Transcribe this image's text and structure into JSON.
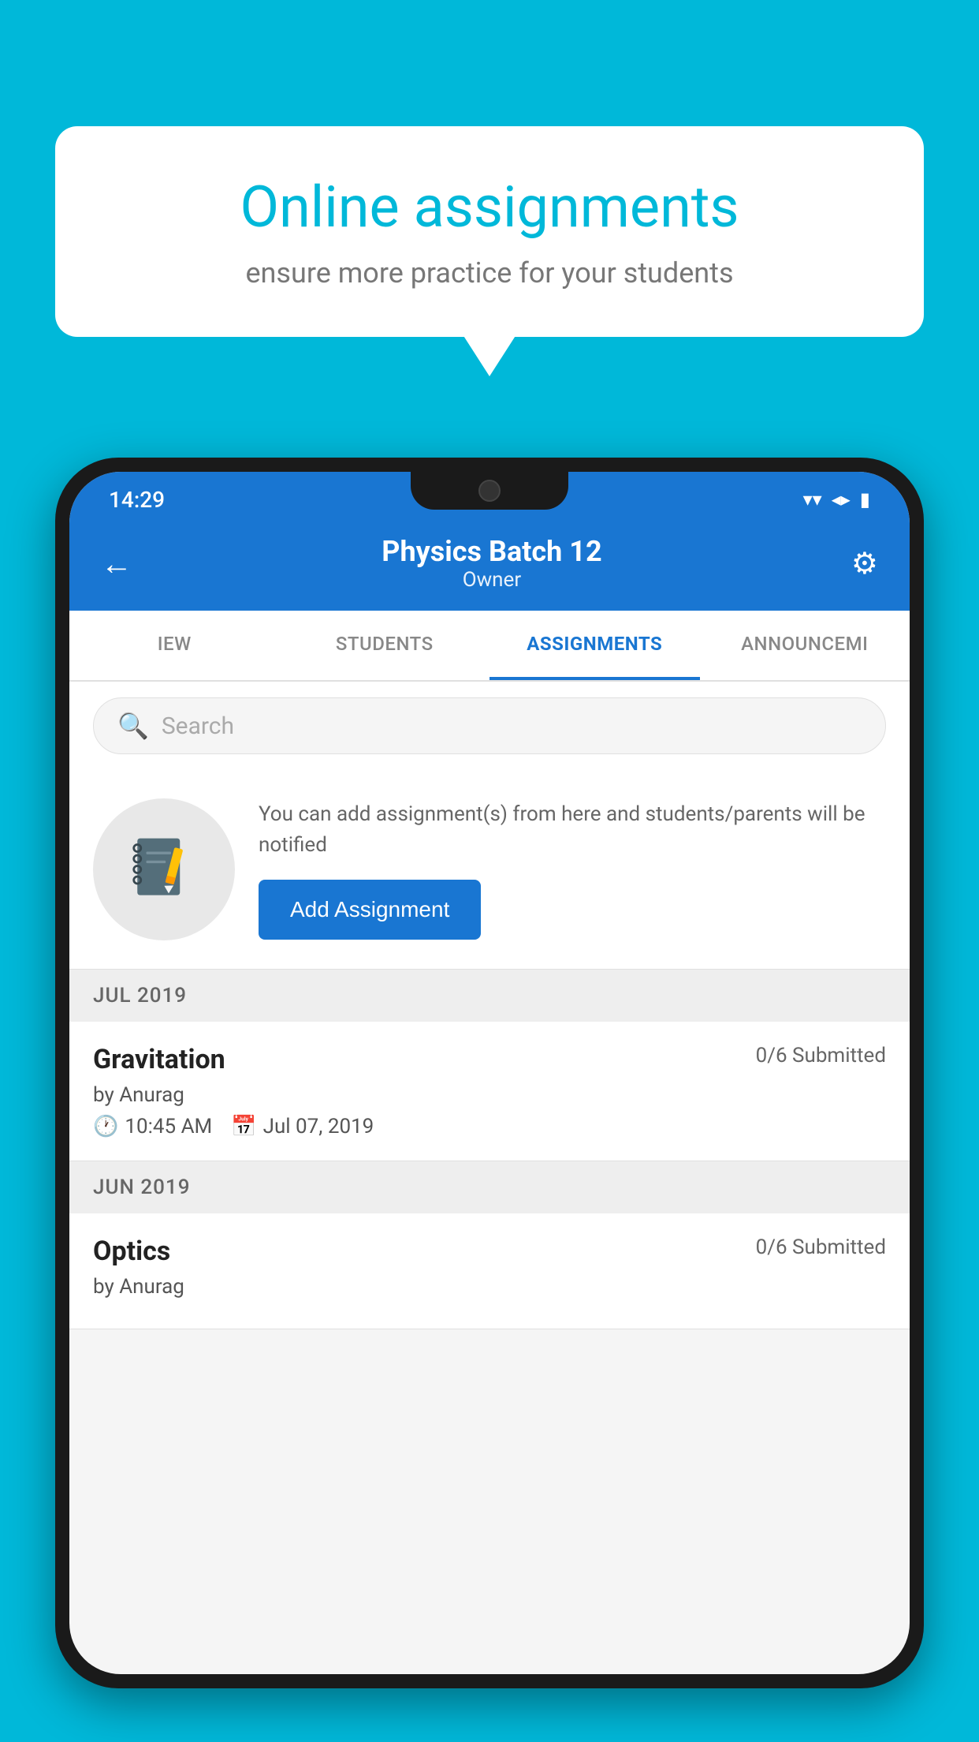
{
  "background_color": "#00B8D9",
  "speech_bubble": {
    "title": "Online assignments",
    "subtitle": "ensure more practice for your students"
  },
  "status_bar": {
    "time": "14:29",
    "wifi": "▼",
    "signal": "▲",
    "battery": "▮"
  },
  "header": {
    "title": "Physics Batch 12",
    "subtitle": "Owner",
    "back_label": "←",
    "settings_label": "⚙"
  },
  "tabs": [
    {
      "label": "IEW",
      "active": false
    },
    {
      "label": "STUDENTS",
      "active": false
    },
    {
      "label": "ASSIGNMENTS",
      "active": true
    },
    {
      "label": "ANNOUNCEMI",
      "active": false
    }
  ],
  "search": {
    "placeholder": "Search"
  },
  "promo": {
    "text": "You can add assignment(s) from here and students/parents will be notified",
    "button_label": "Add Assignment"
  },
  "sections": [
    {
      "header": "JUL 2019",
      "assignments": [
        {
          "name": "Gravitation",
          "submitted": "0/6 Submitted",
          "by": "by Anurag",
          "time": "10:45 AM",
          "date": "Jul 07, 2019"
        }
      ]
    },
    {
      "header": "JUN 2019",
      "assignments": [
        {
          "name": "Optics",
          "submitted": "0/6 Submitted",
          "by": "by Anurag",
          "time": "",
          "date": ""
        }
      ]
    }
  ]
}
